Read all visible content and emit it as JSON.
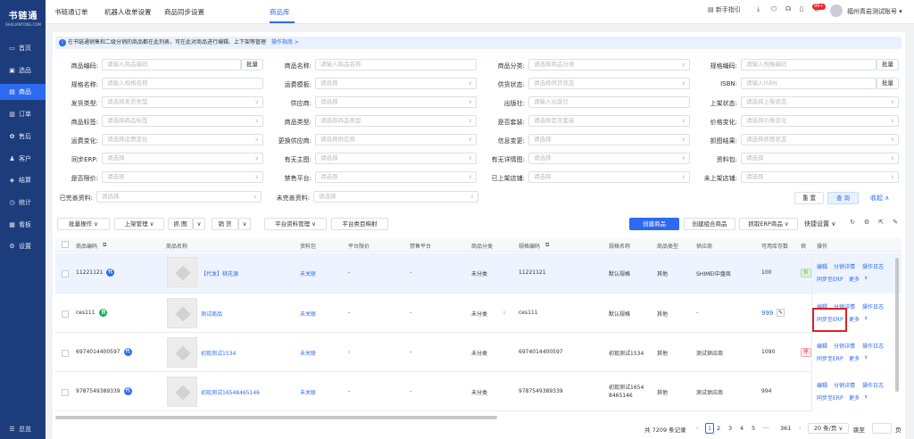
{
  "app": {
    "logo": "书链通",
    "logo_sub": "SHULIANTONG.COM"
  },
  "sidebar": {
    "items": [
      {
        "label": "首页",
        "icon": "monitor-icon"
      },
      {
        "label": "选品",
        "icon": "box-icon"
      },
      {
        "label": "商品",
        "icon": "goods-icon"
      },
      {
        "label": "订单",
        "icon": "order-icon"
      },
      {
        "label": "售后",
        "icon": "after-sale-icon"
      },
      {
        "label": "客户",
        "icon": "customer-icon"
      },
      {
        "label": "结算",
        "icon": "settlement-icon"
      },
      {
        "label": "统计",
        "icon": "stats-icon"
      },
      {
        "label": "看板",
        "icon": "board-icon"
      },
      {
        "label": "设置",
        "icon": "settings-icon"
      }
    ],
    "active_index": 2,
    "collapse_label": "总览"
  },
  "topbar": {
    "tabs": [
      "书链通订单",
      "机器人收单设置",
      "商品同步设置",
      "商品库"
    ],
    "active_tab": "商品库",
    "guide": "新手指引",
    "badge": "99+",
    "account": "福州青岩测试账号"
  },
  "notice": {
    "text": "在书链通销售和二级分销的商品都在此列表，可在此对商品进行编辑、上下架等管理",
    "link": "操作指南 >"
  },
  "filters": {
    "fields": [
      {
        "label": "商品编码:",
        "placeholder": "请输入商品编码",
        "kind": "bulk"
      },
      {
        "label": "商品名称:",
        "placeholder": "请输入商品名称",
        "kind": "text"
      },
      {
        "label": "商品分类:",
        "placeholder": "请选择商品分类",
        "kind": "select"
      },
      {
        "label": "规格编码:",
        "placeholder": "请输入规格编码",
        "kind": "bulk"
      },
      {
        "label": "规格名称:",
        "placeholder": "请输入规格名称",
        "kind": "text"
      },
      {
        "label": "运费模板:",
        "placeholder": "请选择",
        "kind": "select"
      },
      {
        "label": "供货状态:",
        "placeholder": "请选择供货状态",
        "kind": "select"
      },
      {
        "label": "ISBN:",
        "placeholder": "请输入ISBN",
        "kind": "bulk"
      },
      {
        "label": "发货类型:",
        "placeholder": "请选择发货类型",
        "kind": "select"
      },
      {
        "label": "供应商:",
        "placeholder": "请选择",
        "kind": "select"
      },
      {
        "label": "出版社:",
        "placeholder": "请输入出版社",
        "kind": "text"
      },
      {
        "label": "上架状态:",
        "placeholder": "请选择上架状态",
        "kind": "select"
      },
      {
        "label": "商品标签:",
        "placeholder": "请选择商品标签",
        "kind": "select"
      },
      {
        "label": "商品类型:",
        "placeholder": "请选择商品类型",
        "kind": "select"
      },
      {
        "label": "是否套装:",
        "placeholder": "请选择是否套装",
        "kind": "select"
      },
      {
        "label": "价格变化:",
        "placeholder": "请选择价格变化",
        "kind": "select"
      },
      {
        "label": "运费变化:",
        "placeholder": "请选择运费变化",
        "kind": "select"
      },
      {
        "label": "更换供应商:",
        "placeholder": "请选择供应商",
        "kind": "select"
      },
      {
        "label": "信息变更:",
        "placeholder": "请选择",
        "kind": "select"
      },
      {
        "label": "抓图结果:",
        "placeholder": "请选择抓图状态",
        "kind": "select"
      },
      {
        "label": "同步ERP:",
        "placeholder": "请选择",
        "kind": "select"
      },
      {
        "label": "有无主图:",
        "placeholder": "请选择",
        "kind": "select"
      },
      {
        "label": "有无详情图:",
        "placeholder": "请选择",
        "kind": "select"
      },
      {
        "label": "资料包:",
        "placeholder": "请选择",
        "kind": "select"
      },
      {
        "label": "是否限价:",
        "placeholder": "请选择",
        "kind": "select"
      },
      {
        "label": "禁售平台:",
        "placeholder": "请选择",
        "kind": "select"
      },
      {
        "label": "已上架店铺:",
        "placeholder": "请选择",
        "kind": "select"
      },
      {
        "label": "未上架店铺:",
        "placeholder": "请选择",
        "kind": "select"
      },
      {
        "label": "已完善资料:",
        "placeholder": "请选择",
        "kind": "select"
      },
      {
        "label": "未完善资料:",
        "placeholder": "请选择",
        "kind": "select"
      }
    ],
    "bulk_label": "批量",
    "reset": "重 置",
    "search": "查 询",
    "collapse": "收起"
  },
  "toolbar": {
    "batch": "批量操作",
    "shelf": "上架管理",
    "image": "抓 图",
    "sell": "销 货",
    "platform": "平台资料管理",
    "map": "平台类目映射",
    "create": "创建商品",
    "create_combo": "创建组合商品",
    "fetch_erp": "抓取ERP商品",
    "quick": "快捷设置"
  },
  "table": {
    "columns": [
      "商品编码",
      "商品名称",
      "资料包",
      "平台限价",
      "禁售平台",
      "商品分类",
      "规格编码",
      "规格名称",
      "商品类型",
      "供应商",
      "可用库存数",
      "供",
      "操作"
    ],
    "rows": [
      {
        "code": "11221121",
        "tag": "代",
        "tag_color": "#2d6af0",
        "name": "【代发】桃花源",
        "pkg": "未关联",
        "limit": "-",
        "ban": "-",
        "cat": "未分类",
        "sku_code": "11221121",
        "sku_name": "默认规格",
        "type": "其他",
        "supplier": "SHIMEI中盘商",
        "stock": "100",
        "status": "供",
        "status_color": "#52c41a",
        "ops": [
          "编辑",
          "分销详情",
          "操作日志",
          "同步至ERP",
          "更多"
        ]
      },
      {
        "code": "ces111",
        "tag": "自",
        "tag_color": "#1aad5c",
        "name": "测试商品",
        "pkg": "未关联",
        "limit": "-",
        "ban": "-",
        "cat": "未分类",
        "sku_code": "ces111",
        "sku_name": "默认规格",
        "type": "其他",
        "supplier": "-",
        "stock": "999",
        "status": "",
        "status_color": "",
        "ops": [
          "编辑",
          "分销详情",
          "操作日志",
          "同步至ERP",
          "更多"
        ]
      },
      {
        "code": "6974014400597",
        "tag": "代",
        "tag_color": "#2d6af0",
        "name": "初现测试1534",
        "pkg": "未关联",
        "limit": "-",
        "ban": "-",
        "cat": "未分类",
        "sku_code": "6974014400597",
        "sku_name": "初现测试1534",
        "type": "其他",
        "supplier": "测试供应商",
        "stock": "1090",
        "status": "停",
        "status_color": "#f5222d",
        "ops": [
          "编辑",
          "分销详情",
          "操作日志",
          "同步至ERP",
          "更多"
        ]
      },
      {
        "code": "9787549389339",
        "tag": "代",
        "tag_color": "#2d6af0",
        "name": "初现测试16548465146",
        "pkg": "未关联",
        "limit": "-",
        "ban": "-",
        "cat": "未分类",
        "sku_code": "9787549389339",
        "sku_name": "初现测试16548465146",
        "type": "其他",
        "supplier": "测试供应商",
        "stock": "994",
        "status": "",
        "status_color": "",
        "ops": [
          "编辑",
          "分销详情",
          "操作日志",
          "同步至ERP",
          "更多"
        ]
      }
    ]
  },
  "pager": {
    "total": "共 7209 条记录",
    "pages": [
      "1",
      "2",
      "3",
      "4",
      "5",
      "···",
      "361"
    ],
    "page_size": "20 条/页",
    "jump_label": "跳至",
    "page_suffix": "页"
  }
}
